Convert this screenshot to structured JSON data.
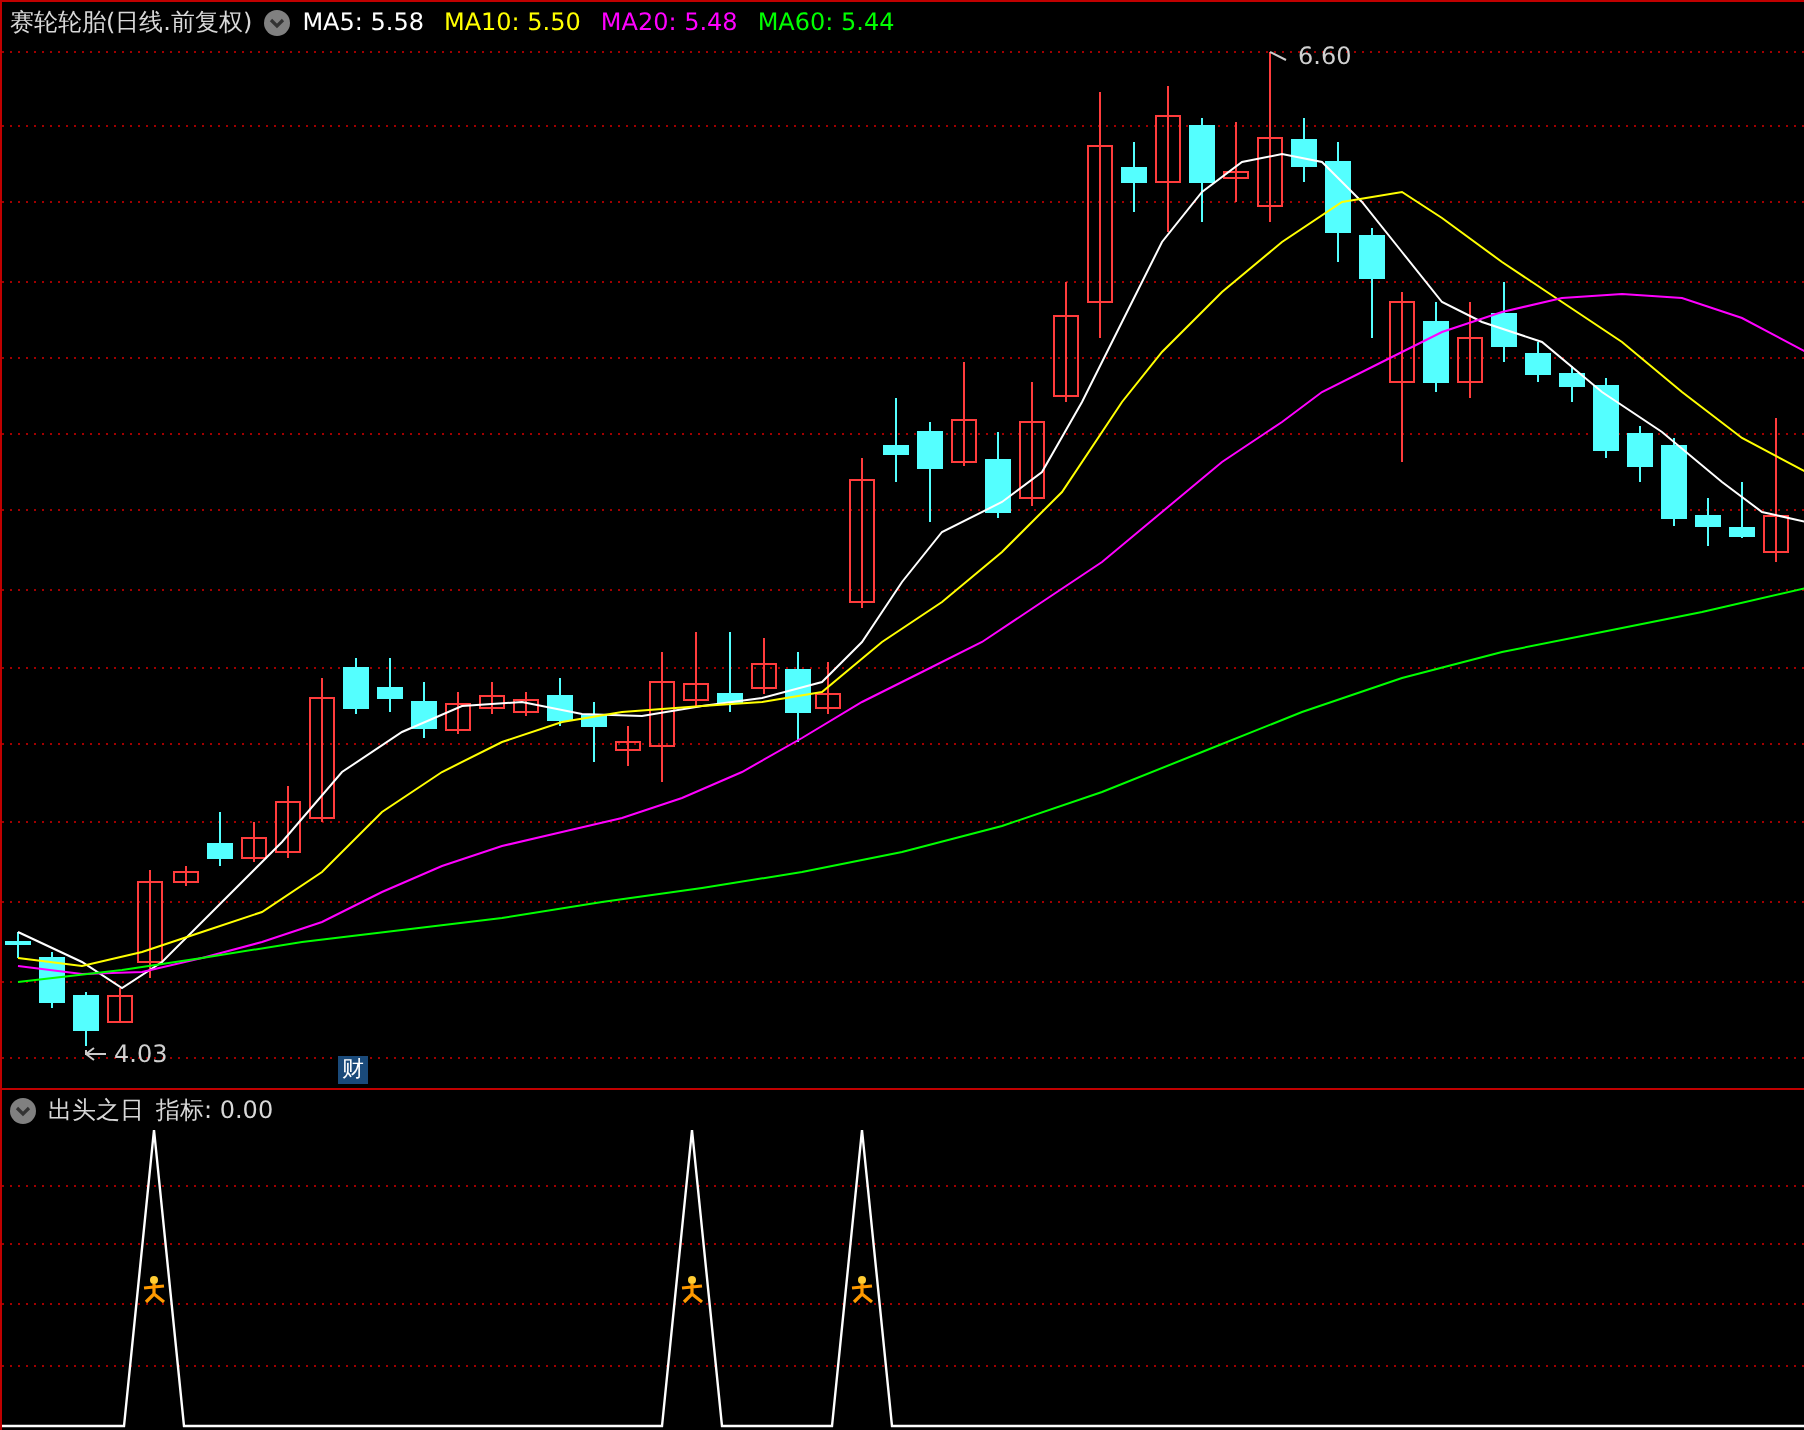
{
  "header": {
    "title": "赛轮轮胎(日线.前复权)",
    "legend": [
      {
        "label": "MA5: 5.58",
        "color": "#ffffff"
      },
      {
        "label": "MA10: 5.50",
        "color": "#ffff00"
      },
      {
        "label": "MA20: 5.48",
        "color": "#ff00ff"
      },
      {
        "label": "MA60: 5.44",
        "color": "#00ff00"
      }
    ]
  },
  "chart": {
    "high_label": "6.60",
    "low_label": "4.03",
    "event_badge": "财"
  },
  "indicator": {
    "title": "出头之日",
    "reading": "指标: 0.00"
  }
}
